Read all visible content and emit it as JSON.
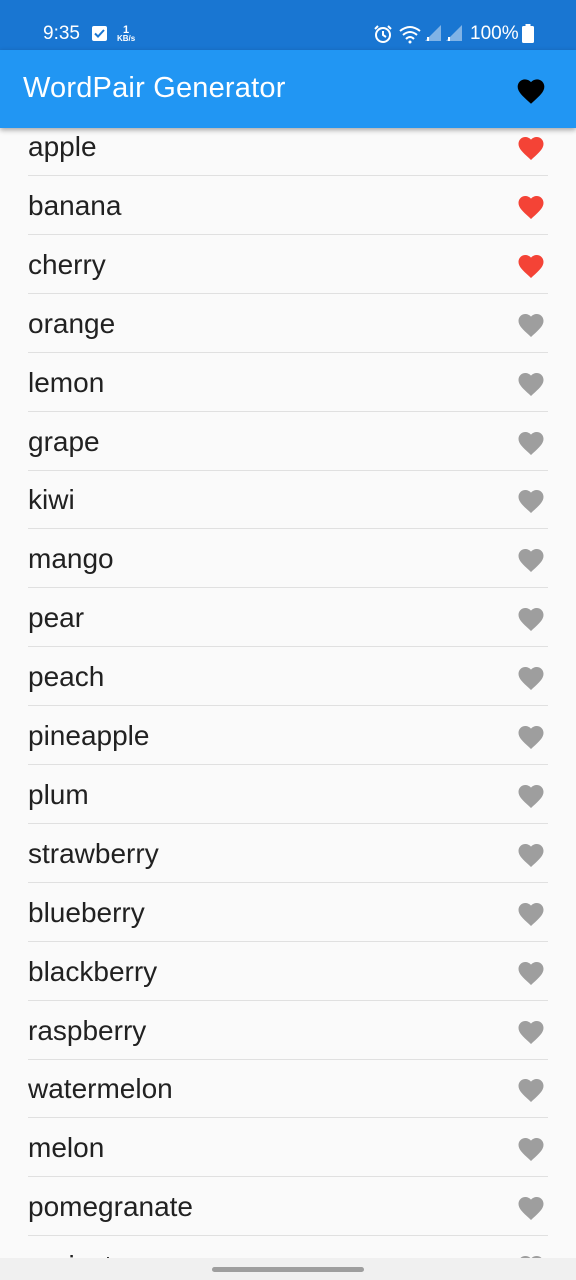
{
  "status_bar": {
    "time": "9:35",
    "net_speed_value": "1",
    "net_speed_unit": "KB/s",
    "battery": "100%"
  },
  "app_bar": {
    "title": "WordPair Generator",
    "favorites_icon": "heart-icon"
  },
  "colors": {
    "app_bar": "#2196f3",
    "status_bar": "#1976d2",
    "favorite": "#f44336",
    "not_favorite": "#9e9e9e"
  },
  "items": [
    {
      "label": "apple",
      "favorite": true
    },
    {
      "label": "banana",
      "favorite": true
    },
    {
      "label": "cherry",
      "favorite": true
    },
    {
      "label": "orange",
      "favorite": false
    },
    {
      "label": "lemon",
      "favorite": false
    },
    {
      "label": "grape",
      "favorite": false
    },
    {
      "label": "kiwi",
      "favorite": false
    },
    {
      "label": "mango",
      "favorite": false
    },
    {
      "label": "pear",
      "favorite": false
    },
    {
      "label": "peach",
      "favorite": false
    },
    {
      "label": "pineapple",
      "favorite": false
    },
    {
      "label": "plum",
      "favorite": false
    },
    {
      "label": "strawberry",
      "favorite": false
    },
    {
      "label": "blueberry",
      "favorite": false
    },
    {
      "label": "blackberry",
      "favorite": false
    },
    {
      "label": "raspberry",
      "favorite": false
    },
    {
      "label": "watermelon",
      "favorite": false
    },
    {
      "label": "melon",
      "favorite": false
    },
    {
      "label": "pomegranate",
      "favorite": false
    },
    {
      "label": "apricot",
      "favorite": false
    }
  ]
}
